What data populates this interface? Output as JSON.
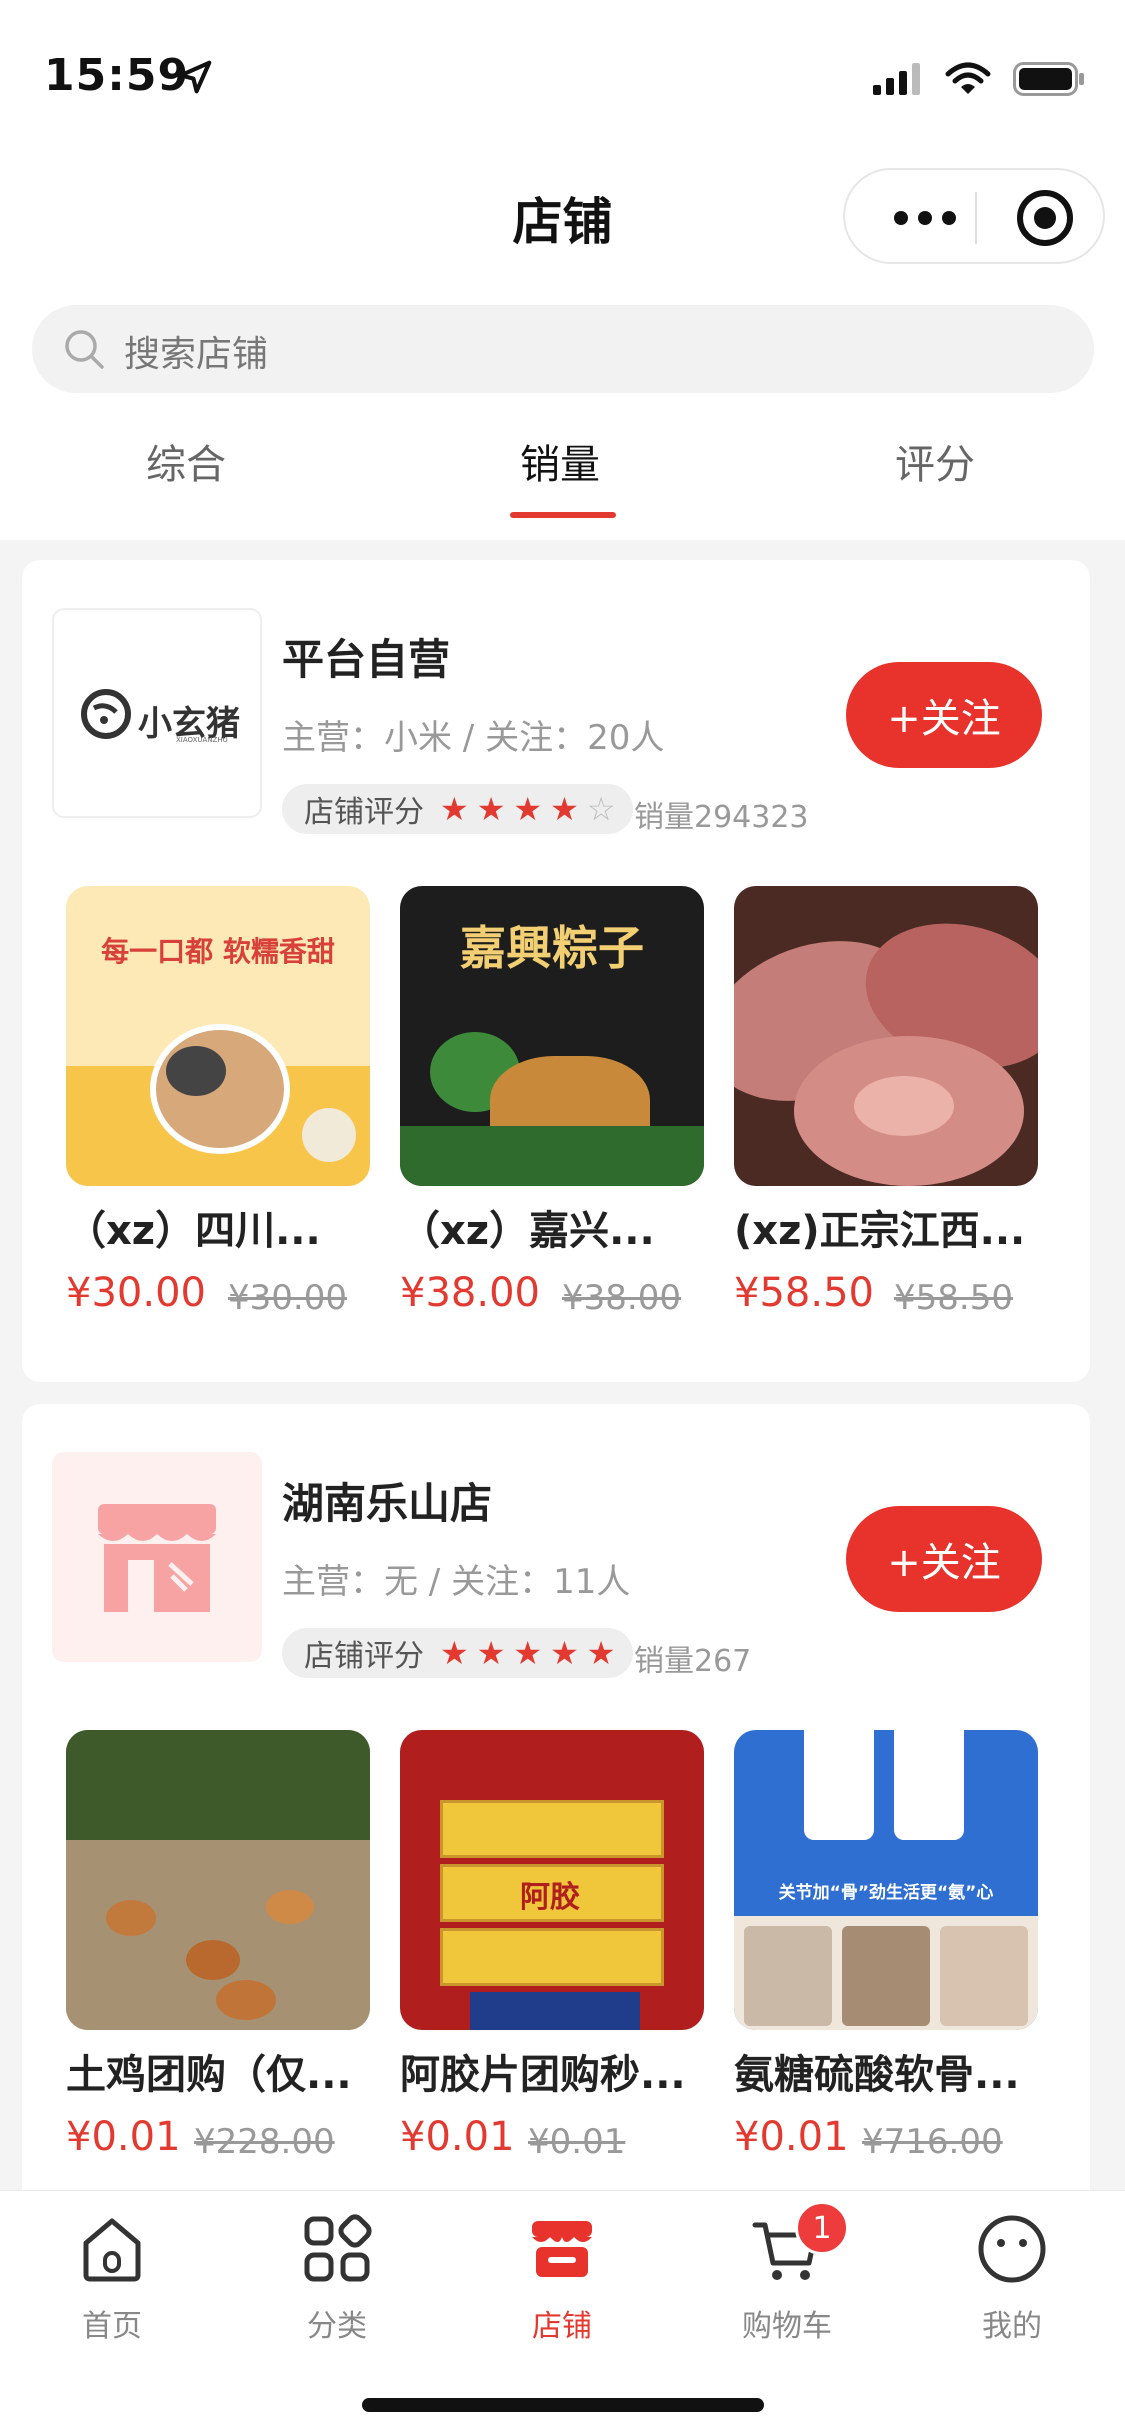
{
  "status_bar": {
    "time": "15:59"
  },
  "header": {
    "title": "店铺"
  },
  "search": {
    "placeholder": "搜索店铺"
  },
  "tabs": [
    {
      "label": "综合",
      "active": false
    },
    {
      "label": "销量",
      "active": true
    },
    {
      "label": "评分",
      "active": false
    }
  ],
  "shops": [
    {
      "name": "平台自营",
      "info": "主营：小米 / 关注：20人",
      "rating_label": "店铺评分",
      "stars": 4,
      "sales": "销量294323",
      "follow_label": "+关注",
      "logo_text": "小玄猪",
      "logo_subtext": "XIAOXUANZHU",
      "products": [
        {
          "name": "（xz）四川...",
          "price": "¥30.00",
          "original_price": "¥30.00",
          "img_text": "每一口都 软糯香甜"
        },
        {
          "name": "（xz）嘉兴...",
          "price": "¥38.00",
          "original_price": "¥38.00",
          "img_text": "嘉興粽子"
        },
        {
          "name": "(xz)正宗江西...",
          "price": "¥58.50",
          "original_price": "¥58.50"
        }
      ]
    },
    {
      "name": "湖南乐山店",
      "info": "主营：无 / 关注：11人",
      "rating_label": "店铺评分",
      "stars": 5,
      "sales": "销量267",
      "follow_label": "+关注",
      "products": [
        {
          "name": "土鸡团购（仅...",
          "price": "¥0.01",
          "original_price": "¥228.00"
        },
        {
          "name": "阿胶片团购秒...",
          "price": "¥0.01",
          "original_price": "¥0.01",
          "img_text": "阿胶"
        },
        {
          "name": "氨糖硫酸软骨...",
          "price": "¥0.01",
          "original_price": "¥716.00",
          "img_text": "关节加“骨”劲生活更“氨”心"
        }
      ]
    }
  ],
  "tabbar": {
    "items": [
      {
        "label": "首页",
        "icon": "home-icon"
      },
      {
        "label": "分类",
        "icon": "category-icon"
      },
      {
        "label": "店铺",
        "icon": "shop-icon",
        "active": true
      },
      {
        "label": "购物车",
        "icon": "cart-icon",
        "badge": "1"
      },
      {
        "label": "我的",
        "icon": "profile-icon"
      }
    ]
  },
  "colors": {
    "accent": "#e8322c",
    "price": "#e23a30"
  }
}
